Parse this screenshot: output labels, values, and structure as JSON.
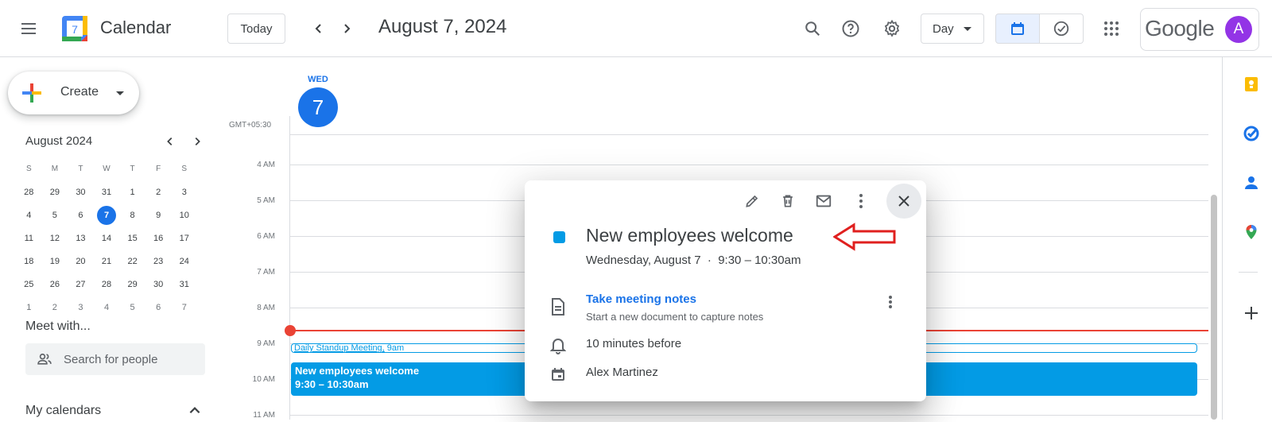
{
  "header": {
    "app_title": "Calendar",
    "logo_day": "7",
    "today_label": "Today",
    "date_title": "August 7, 2024",
    "view_select": "Day",
    "google_word": "Google",
    "avatar_letter": "A"
  },
  "sidebar": {
    "create_label": "Create",
    "mini_month": "August 2024",
    "weekday_heads": [
      "S",
      "M",
      "T",
      "W",
      "T",
      "F",
      "S"
    ],
    "weeks": [
      [
        "28",
        "29",
        "30",
        "31",
        "1",
        "2",
        "3"
      ],
      [
        "4",
        "5",
        "6",
        "7",
        "8",
        "9",
        "10"
      ],
      [
        "11",
        "12",
        "13",
        "14",
        "15",
        "16",
        "17"
      ],
      [
        "18",
        "19",
        "20",
        "21",
        "22",
        "23",
        "24"
      ],
      [
        "25",
        "26",
        "27",
        "28",
        "29",
        "30",
        "31"
      ],
      [
        "1",
        "2",
        "3",
        "4",
        "5",
        "6",
        "7"
      ]
    ],
    "meet_title": "Meet with...",
    "search_placeholder": "Search for people",
    "my_calendars": "My calendars"
  },
  "day_view": {
    "day_of_week": "WED",
    "day_number": "7",
    "timezone": "GMT+05:30",
    "hours": [
      "4 AM",
      "5 AM",
      "6 AM",
      "7 AM",
      "8 AM",
      "9 AM",
      "10 AM",
      "11 AM"
    ],
    "events": {
      "standup_title": "Daily Standup Meeting,",
      "standup_time": " 9am",
      "welcome_title": "New employees welcome",
      "welcome_time": "9:30 – 10:30am"
    }
  },
  "popup": {
    "title": "New employees welcome",
    "subtitle": "Wednesday, August 7  ·  9:30 – 10:30am",
    "notes_link": "Take meeting notes",
    "notes_sub": "Start a new document to capture notes",
    "reminder": "10 minutes before",
    "organizer": "Alex Martinez"
  },
  "colors": {
    "accent": "#1a73e8",
    "event": "#039be5",
    "now_line": "#ea4335",
    "avatar": "#9334e6"
  }
}
